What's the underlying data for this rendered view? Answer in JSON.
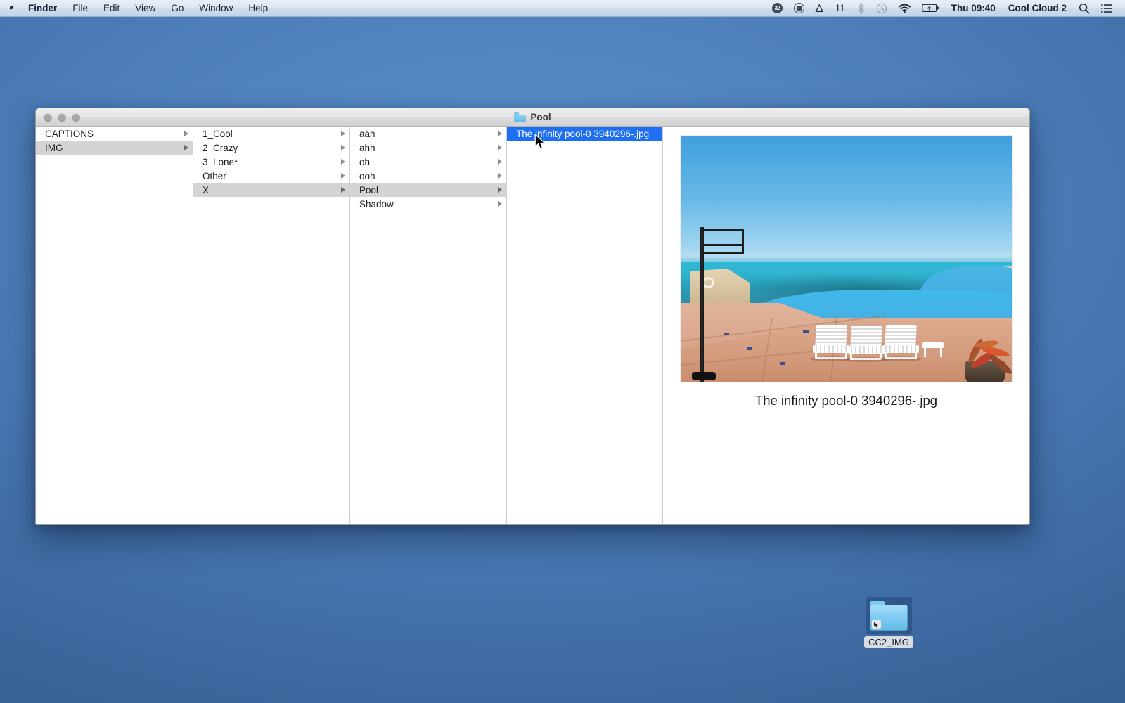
{
  "menubar": {
    "apple_icon": "apple-logo-icon",
    "items": [
      {
        "label": "Finder",
        "bold": true
      },
      {
        "label": "File",
        "bold": false
      },
      {
        "label": "Edit",
        "bold": false
      },
      {
        "label": "View",
        "bold": false
      },
      {
        "label": "Go",
        "bold": false
      },
      {
        "label": "Window",
        "bold": false
      },
      {
        "label": "Help",
        "bold": false
      }
    ],
    "status": {
      "badge_count": "32",
      "record_icon": "record-stop-icon",
      "adobe_icon": "adobe-a-icon",
      "adobe_count": "11",
      "bluetooth_icon": "bluetooth-icon",
      "timemachine_icon": "time-machine-icon",
      "wifi_icon": "wifi-icon",
      "battery_icon": "battery-charging-icon",
      "clock": "Thu 09:40",
      "user": "Cool Cloud 2",
      "search_icon": "search-icon",
      "notification_icon": "notification-center-icon"
    }
  },
  "window": {
    "title": "Pool",
    "title_icon": "folder-icon",
    "traffic_lights": [
      "close-button",
      "minimize-button",
      "zoom-button"
    ]
  },
  "browser": {
    "columns": [
      {
        "name": "column-1",
        "rows": [
          {
            "label": "CAPTIONS",
            "arrow": true,
            "state": "normal"
          },
          {
            "label": "IMG",
            "arrow": true,
            "state": "selected-inactive"
          }
        ]
      },
      {
        "name": "column-2",
        "rows": [
          {
            "label": "1_Cool",
            "arrow": true,
            "state": "normal"
          },
          {
            "label": "2_Crazy",
            "arrow": true,
            "state": "normal"
          },
          {
            "label": "3_Lone*",
            "arrow": true,
            "state": "normal"
          },
          {
            "label": "Other",
            "arrow": true,
            "state": "normal"
          },
          {
            "label": "X",
            "arrow": true,
            "state": "selected-inactive"
          }
        ]
      },
      {
        "name": "column-3",
        "rows": [
          {
            "label": "aah",
            "arrow": true,
            "state": "normal"
          },
          {
            "label": "ahh",
            "arrow": true,
            "state": "normal"
          },
          {
            "label": "oh",
            "arrow": true,
            "state": "normal"
          },
          {
            "label": "ooh",
            "arrow": true,
            "state": "normal"
          },
          {
            "label": "Pool",
            "arrow": true,
            "state": "selected-inactive"
          },
          {
            "label": "Shadow",
            "arrow": true,
            "state": "normal"
          }
        ]
      },
      {
        "name": "column-4",
        "rows": [
          {
            "label": "The infinity pool-0 3940296-.jpg",
            "arrow": false,
            "state": "selected-active"
          }
        ]
      }
    ]
  },
  "preview": {
    "filename": "The infinity pool-0 3940296-.jpg",
    "image_alt": "infinity-pool-photo"
  },
  "desktop": {
    "icon": {
      "label": "CC2_IMG",
      "type": "folder-alias-icon",
      "selected": true
    }
  },
  "colors": {
    "selection_blue": "#1e6ff1",
    "selection_gray": "#d4d4d4",
    "desktop_blue": "#4878b3",
    "folder_blue": "#7ecbf0"
  }
}
